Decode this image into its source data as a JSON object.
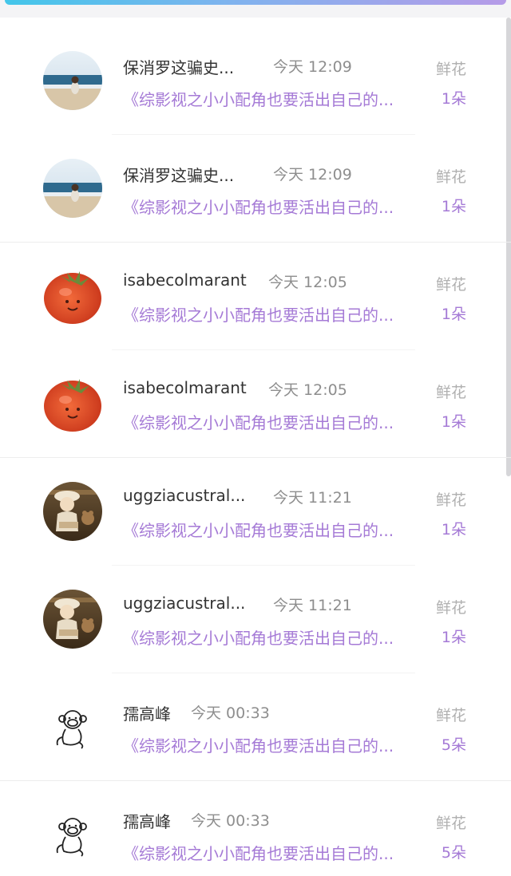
{
  "colors": {
    "accent_purple": "#a57ad6",
    "gradient_start": "#43c6ea",
    "gradient_end": "#b69be8"
  },
  "items": [
    {
      "avatar": "beach-icon",
      "name": "保消罗这骗史...",
      "time": "今天 12:09",
      "gift": "鲜花",
      "book": "《综影视之小小配角也要活出自己的...",
      "count": "1朵"
    },
    {
      "avatar": "beach-icon",
      "name": "保消罗这骗史...",
      "time": "今天 12:09",
      "gift": "鲜花",
      "book": "《综影视之小小配角也要活出自己的...",
      "count": "1朵"
    },
    {
      "avatar": "tomato-icon",
      "name": "isabecolmarant",
      "time": "今天 12:05",
      "gift": "鲜花",
      "book": "《综影视之小小配角也要活出自己的...",
      "count": "1朵"
    },
    {
      "avatar": "tomato-icon",
      "name": "isabecolmarant",
      "time": "今天 12:05",
      "gift": "鲜花",
      "book": "《综影视之小小配角也要活出自己的...",
      "count": "1朵"
    },
    {
      "avatar": "doll-icon",
      "name": "uggziacustral...",
      "time": "今天 11:21",
      "gift": "鲜花",
      "book": "《综影视之小小配角也要活出自己的...",
      "count": "1朵"
    },
    {
      "avatar": "doll-icon",
      "name": "uggziacustral...",
      "time": "今天 11:21",
      "gift": "鲜花",
      "book": "《综影视之小小配角也要活出自己的...",
      "count": "1朵"
    },
    {
      "avatar": "monkey-icon",
      "name": "孺高峰",
      "time": "今天 00:33",
      "gift": "鲜花",
      "book": "《综影视之小小配角也要活出自己的...",
      "count": "5朵"
    },
    {
      "avatar": "monkey-icon",
      "name": "孺高峰",
      "time": "今天 00:33",
      "gift": "鲜花",
      "book": "《综影视之小小配角也要活出自己的...",
      "count": "5朵"
    }
  ]
}
